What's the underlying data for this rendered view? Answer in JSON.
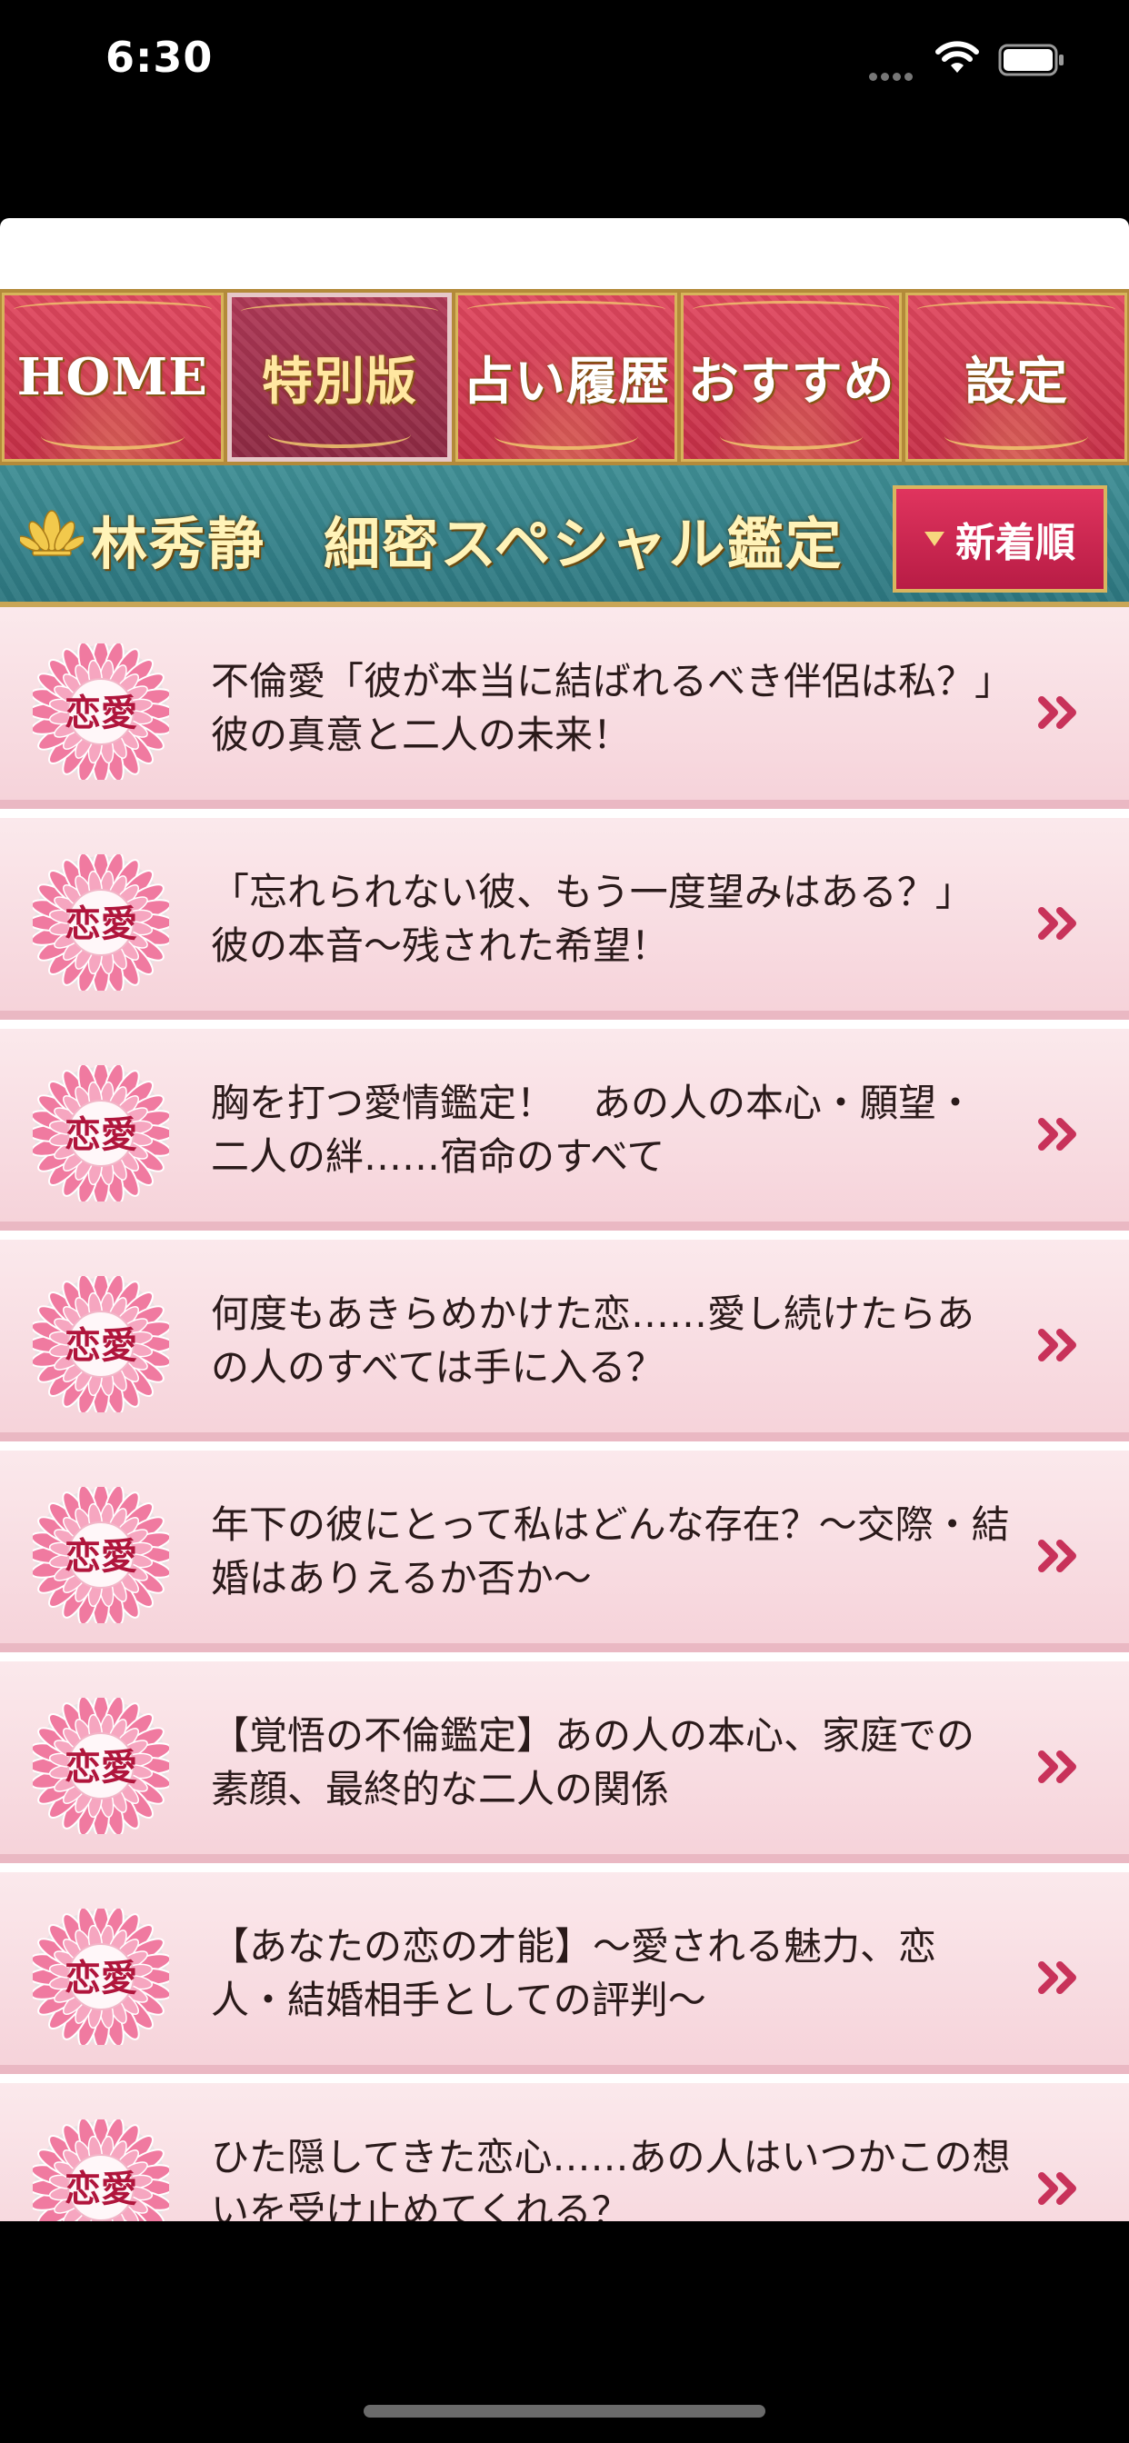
{
  "status_bar": {
    "time": "6:30",
    "icons": [
      "signal-dots-icon",
      "wifi-icon",
      "battery-icon"
    ]
  },
  "tabs": [
    {
      "label": "HOME",
      "active": false
    },
    {
      "label": "特別版",
      "active": true
    },
    {
      "label": "占い履歴",
      "active": false
    },
    {
      "label": "おすすめ",
      "active": false
    },
    {
      "label": "設定",
      "active": false
    }
  ],
  "banner": {
    "title": "林秀静　細密スペシャル鑑定",
    "sort_label": "新着順",
    "icons": [
      "lotus-icon",
      "triangle-down-icon"
    ]
  },
  "list": {
    "badge_label": "恋愛",
    "badge_icon": "chrysanthemum-badge-icon",
    "chevron_icon": "double-chevron-right-icon",
    "items": [
      {
        "text": "不倫愛「彼が本当に結ばれるべき伴侶は私？」彼の真意と二人の未来！"
      },
      {
        "text": "「忘れられない彼、もう一度望みはある？」彼の本音〜残された希望！"
      },
      {
        "text": "胸を打つ愛情鑑定！　あの人の本心・願望・二人の絆……宿命のすべて"
      },
      {
        "text": "何度もあきらめかけた恋……愛し続けたらあの人のすべては手に入る？"
      },
      {
        "text": "年下の彼にとって私はどんな存在？〜交際・結婚はありえるか否か〜"
      },
      {
        "text": "【覚悟の不倫鑑定】あの人の本心、家庭での素顔、最終的な二人の関係"
      },
      {
        "text": "【あなたの恋の才能】〜愛される魅力、恋人・結婚相手としての評判〜"
      },
      {
        "text": "ひた隠してきた恋心……あの人はいつかこの想いを受け止めてくれる？"
      }
    ]
  },
  "colors": {
    "tab_red": "#d03a52",
    "tab_active": "#9b3250",
    "banner_teal": "#35808a",
    "gold": "#d7b45a",
    "list_pink": "#f8dde3",
    "chevron": "#c8325a"
  }
}
